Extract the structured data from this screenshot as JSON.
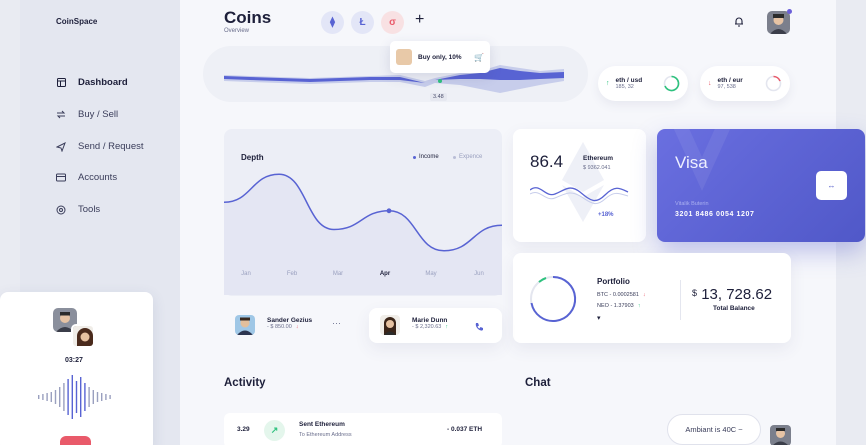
{
  "app": {
    "brand": "CoinSpace"
  },
  "sidebar": {
    "items": [
      {
        "label": "Dashboard",
        "icon": "dashboard-icon",
        "active": true
      },
      {
        "label": "Buy / Sell",
        "icon": "exchange-icon",
        "active": false
      },
      {
        "label": "Send / Request",
        "icon": "send-icon",
        "active": false
      },
      {
        "label": "Accounts",
        "icon": "accounts-icon",
        "active": false
      },
      {
        "label": "Tools",
        "icon": "tools-icon",
        "active": false
      }
    ]
  },
  "header": {
    "title": "Coins",
    "subtitle": "Overview",
    "coins": [
      {
        "name": "ethereum",
        "glyph": "⧫",
        "bg": "#e3e6f7",
        "fg": "#5863d3"
      },
      {
        "name": "litecoin",
        "glyph": "Ł",
        "bg": "#e3e6f7",
        "fg": "#5863d3"
      },
      {
        "name": "other",
        "glyph": "σ",
        "bg": "#f8e1e3",
        "fg": "#e95a6a"
      }
    ],
    "add_label": "+"
  },
  "wave": {
    "tooltip_text": "Buy only, 10%",
    "value_tag": "3.48"
  },
  "pairs": [
    {
      "label": "eth / usd",
      "value": "185, 32",
      "direction": "up",
      "color": "#2ec27e"
    },
    {
      "label": "eth / eur",
      "value": "97, 538",
      "direction": "down",
      "color": "#e95a6a"
    }
  ],
  "depth": {
    "title": "Depth",
    "legend": [
      {
        "label": "Income",
        "color": "#5863d3"
      },
      {
        "label": "Expence",
        "color": "#b9bdd6"
      }
    ]
  },
  "chart_data": {
    "type": "area",
    "title": "Depth",
    "categories": [
      "Jan",
      "Feb",
      "Mar",
      "Apr",
      "May",
      "Jun"
    ],
    "series": [
      {
        "name": "Income",
        "values": [
          0.62,
          0.95,
          0.3,
          0.52,
          0.05,
          0.35
        ]
      }
    ],
    "highlight": "Apr",
    "grid": false,
    "legend": "top-right"
  },
  "ethereum": {
    "value": "86.4",
    "name": "Ethereum",
    "price": "$ 9362.041",
    "change": "+18%"
  },
  "visa": {
    "brand": "Visa",
    "holder": "Vitalik Buterin",
    "number": "3201  8486  0054  1207",
    "action_glyph": "↔"
  },
  "portfolio": {
    "title": "Portfolio",
    "lines": [
      {
        "text": "BTC - 0.0002581",
        "arrow": "↓",
        "color": "#e95a6a"
      },
      {
        "text": "NEO - 1.37903",
        "arrow": "↑",
        "color": "#2ec27e"
      }
    ],
    "currency": "$",
    "total": "13, 728.62",
    "total_label": "Total Balance",
    "more_glyph": "▾"
  },
  "contacts": [
    {
      "name": "Sander Gezius",
      "amount": "- $ 850.00",
      "arrow": "↓",
      "color": "#e95a6a",
      "more": "···"
    },
    {
      "name": "Marie Dunn",
      "amount": "- $ 2,320.63",
      "arrow": "↑",
      "color": "#2ec27e",
      "action": "phone-icon"
    }
  ],
  "activity": {
    "heading": "Activity",
    "rows": [
      {
        "time": "3.29",
        "title": "Sent Ethereum",
        "subtitle": "To Ethereum Address",
        "amount": "- 0.037 ETH",
        "icon": "arrow-up-right-icon"
      }
    ]
  },
  "chat": {
    "heading": "Chat",
    "message": "Ambiant is 40C ~"
  },
  "call": {
    "time": "03:27"
  }
}
